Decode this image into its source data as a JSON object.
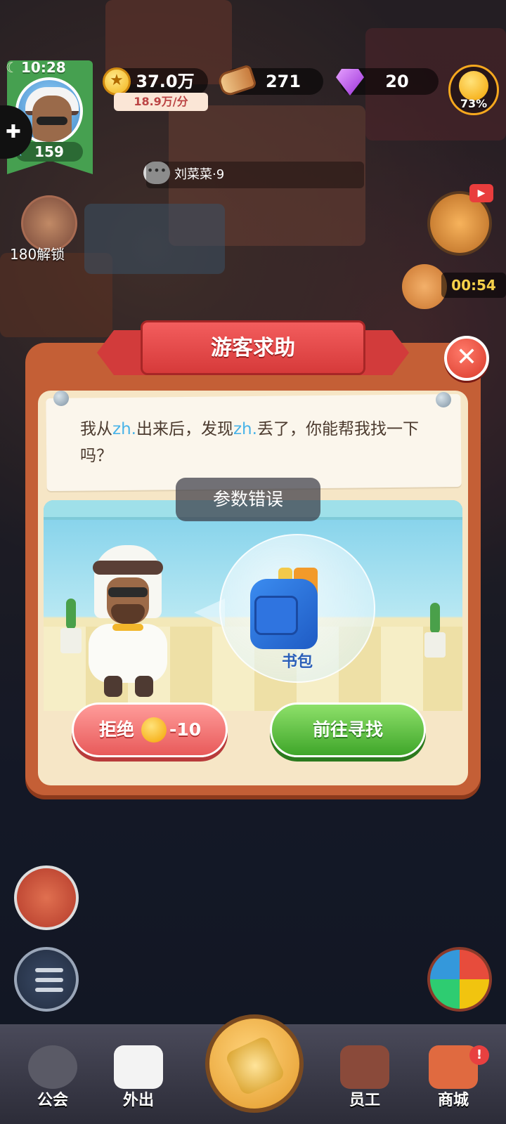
{
  "hud": {
    "time": "10:28",
    "level": "159",
    "coins": "37.0万",
    "coin_rate": "18.9万/分",
    "wood": "271",
    "gems": "20",
    "happiness": "73%"
  },
  "world": {
    "chat_name": "刘菜菜·9",
    "unlock_label": "180解锁",
    "event_timer": "00:54"
  },
  "dialog": {
    "title": "游客求助",
    "message_parts": [
      "我从",
      "zh.",
      "出来后，发现",
      "zh.",
      "丢了，你能帮我找一下吗？"
    ],
    "item_label": "书包",
    "error_toast": "参数错误",
    "refuse_label": "拒绝",
    "refuse_cost": "-10",
    "go_label": "前往寻找",
    "close_icon": "✕"
  },
  "nav": {
    "items": [
      {
        "label": "公会",
        "icon": "guild-icon"
      },
      {
        "label": "外出",
        "icon": "dice-icon"
      },
      {
        "label": "员工",
        "icon": "staff-book-icon"
      },
      {
        "label": "商城",
        "icon": "shop-icon"
      }
    ],
    "shop_badge": "!"
  },
  "colors": {
    "dialog_frame": "#c45f36",
    "banner": "#e04646",
    "refuse_button": "#e85a5a",
    "go_button": "#3fa62a",
    "highlight_text": "#48b3e8"
  }
}
